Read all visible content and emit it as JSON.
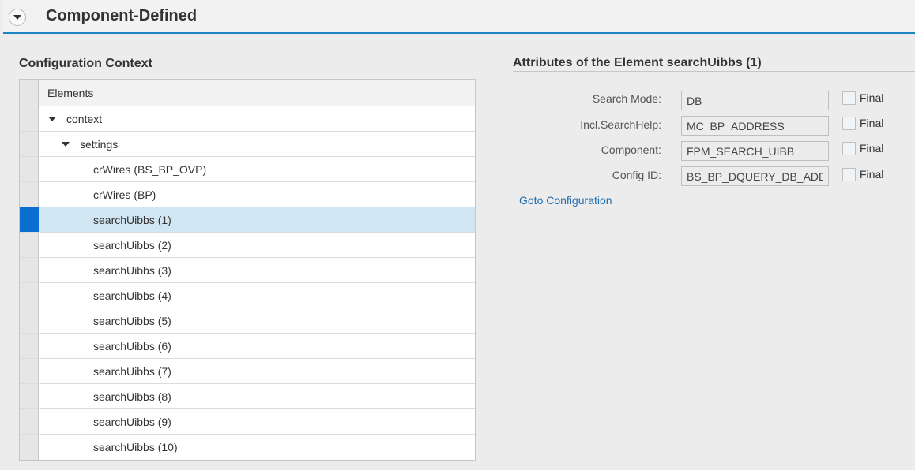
{
  "header": {
    "title": "Component-Defined",
    "collapse_icon": "chevron-down-icon"
  },
  "config_context": {
    "title": "Configuration Context",
    "column_header": "Elements",
    "rows": [
      {
        "label": "context",
        "expanded": true,
        "selected": false
      },
      {
        "label": "settings",
        "expanded": true,
        "selected": false
      },
      {
        "label": "crWires (BS_BP_OVP)",
        "selected": false
      },
      {
        "label": "crWires (BP)",
        "selected": false
      },
      {
        "label": "searchUibbs (1)",
        "selected": true
      },
      {
        "label": "searchUibbs (2)",
        "selected": false
      },
      {
        "label": "searchUibbs (3)",
        "selected": false
      },
      {
        "label": "searchUibbs (4)",
        "selected": false
      },
      {
        "label": "searchUibbs (5)",
        "selected": false
      },
      {
        "label": "searchUibbs (6)",
        "selected": false
      },
      {
        "label": "searchUibbs (7)",
        "selected": false
      },
      {
        "label": "searchUibbs (8)",
        "selected": false
      },
      {
        "label": "searchUibbs (9)",
        "selected": false
      },
      {
        "label": "searchUibbs (10)",
        "selected": false
      }
    ]
  },
  "attributes": {
    "title": "Attributes of the Element searchUibbs (1)",
    "fields": [
      {
        "label": "Search Mode:",
        "value": "DB",
        "final_label": "Final",
        "final_checked": false
      },
      {
        "label": "Incl.SearchHelp:",
        "value": "MC_BP_ADDRESS",
        "final_label": "Final",
        "final_checked": false
      },
      {
        "label": "Component:",
        "value": "FPM_SEARCH_UIBB",
        "final_label": "Final",
        "final_checked": false
      },
      {
        "label": "Config ID:",
        "value": "BS_BP_DQUERY_DB_ADDRESS",
        "final_label": "Final",
        "final_checked": false
      }
    ],
    "goto_link": "Goto Configuration"
  },
  "colors": {
    "accent": "#1d85c5",
    "selection": "#0a6ed1",
    "selected_row": "#d1e6f3",
    "link": "#1f6fb0"
  }
}
